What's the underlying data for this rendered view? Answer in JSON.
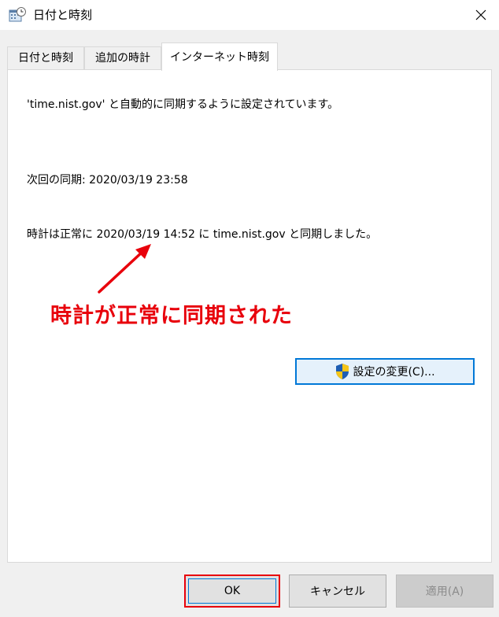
{
  "window": {
    "title": "日付と時刻"
  },
  "tabs": [
    {
      "label": "日付と時刻",
      "active": false
    },
    {
      "label": "追加の時計",
      "active": false
    },
    {
      "label": "インターネット時刻",
      "active": true
    }
  ],
  "panel": {
    "server_line": "'time.nist.gov' と自動的に同期するように設定されています。",
    "next_sync": "次回の同期: 2020/03/19 23:58",
    "last_sync": "時計は正常に 2020/03/19 14:52 に time.nist.gov と同期しました。",
    "annotation": "時計が正常に同期された",
    "change_settings_label": "設定の変更(C)..."
  },
  "footer": {
    "ok_label": "OK",
    "cancel_label": "キャンセル",
    "apply_label": "適用(A)"
  },
  "colors": {
    "annotation": "#e8000b",
    "focus_border": "#0078d7",
    "panel_bg": "#ffffff",
    "window_bg": "#f0f0f0"
  },
  "icons": {
    "window_icon": "calendar-clock-icon",
    "close": "close-icon",
    "uac": "uac-shield-icon",
    "annotation_arrow": "arrow-icon"
  }
}
